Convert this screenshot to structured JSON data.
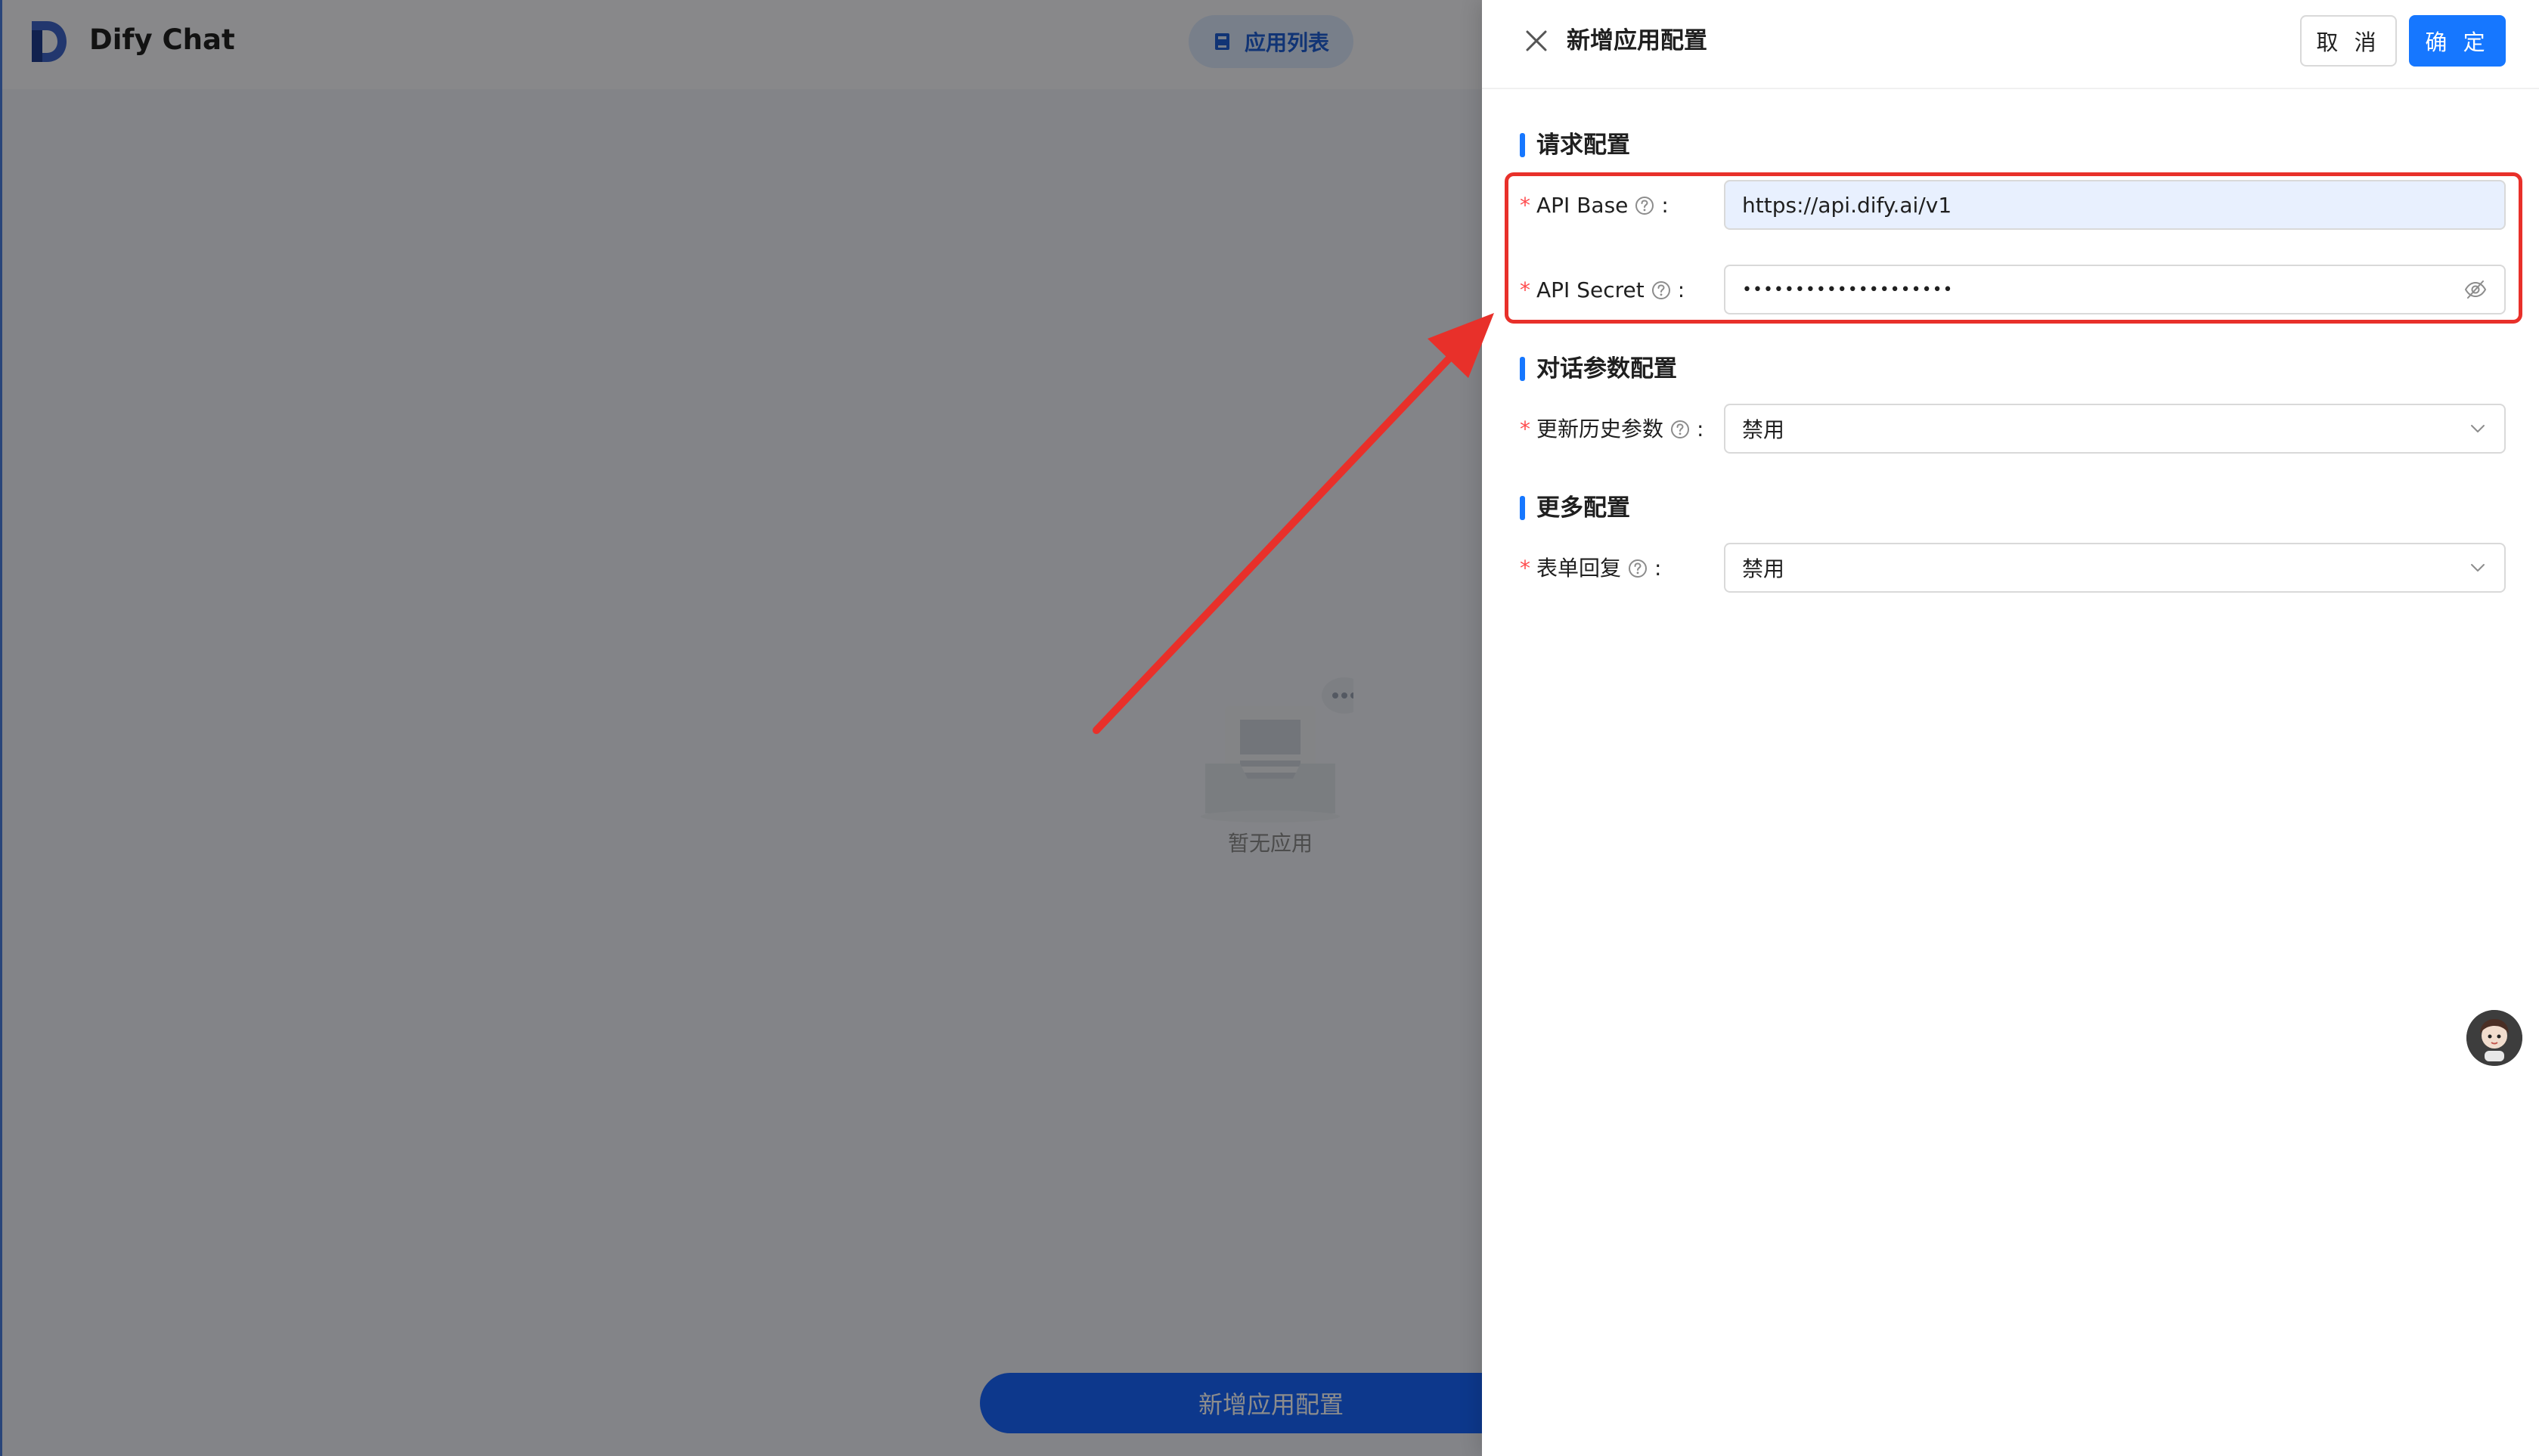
{
  "app": {
    "title": "Dify Chat",
    "app_list_button": "应用列表",
    "empty_text": "暂无应用",
    "new_app_button": "新增应用配置"
  },
  "drawer": {
    "title": "新增应用配置",
    "cancel_label": "取 消",
    "ok_label": "确 定",
    "sections": {
      "request": {
        "title": "请求配置",
        "api_base_label": "API Base",
        "api_base_value": "https://api.dify.ai/v1",
        "api_secret_label": "API Secret",
        "api_secret_value": "••••••••••••••••••••"
      },
      "conversation": {
        "title": "对话参数配置",
        "update_history_label": "更新历史参数",
        "update_history_value": "禁用"
      },
      "more": {
        "title": "更多配置",
        "form_reply_label": "表单回复",
        "form_reply_value": "禁用"
      }
    },
    "colon": ":"
  },
  "colors": {
    "primary": "#1677ff",
    "annotation": "#e8302a",
    "required": "#ff4d4f"
  },
  "icons": [
    "close-icon",
    "help-icon",
    "eye-slash-icon",
    "chevron-down-icon",
    "book-icon",
    "logo-icon"
  ]
}
